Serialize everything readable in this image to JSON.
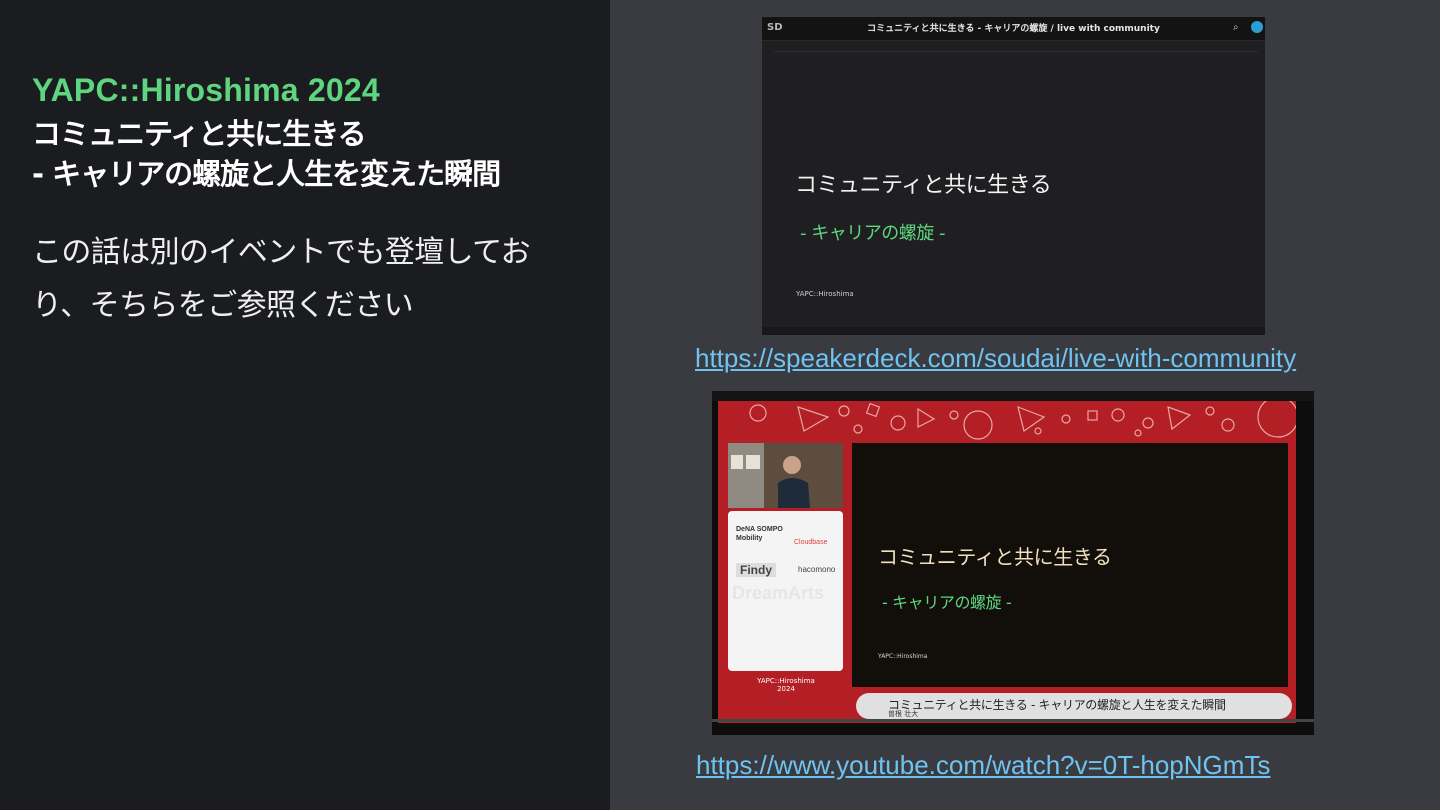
{
  "left": {
    "event": "YAPC::Hiroshima 2024",
    "title_line1": "コミュニティと共に生きる",
    "title_line2": "- キャリアの螺旋と人生を変えた瞬間",
    "body": "この話は別のイベントでも登壇しており、そちらをご参照ください"
  },
  "speakerdeck": {
    "logo": "SD",
    "page_title": "コミュニティと共に生きる - キャリアの螺旋 / live with community",
    "slide_title": "コミュニティと共に生きる",
    "slide_subtitle": "-  キャリアの螺旋 -",
    "slide_footer": "YAPC::Hiroshima",
    "link": "https://speakerdeck.com/soudai/live-with-community"
  },
  "youtube": {
    "slide_title": "コミュニティと共に生きる",
    "slide_subtitle": "-  キャリアの螺旋 -",
    "slide_footer": "YAPC::Hiroshima",
    "sponsors": [
      "DeNA SOMPO Mobility",
      "Cloudbase",
      "Findy",
      "hacomono",
      "DreamArts"
    ],
    "brand": "YAPC::Hiroshima 2024",
    "caption_title": "コミュニティと共に生きる - キャリアの螺旋と人生を変えた瞬間",
    "caption_speaker": "曽根 壮大",
    "link": "https://www.youtube.com/watch?v=0T-hopNGmTs"
  },
  "colors": {
    "accent_green": "#5ed57f",
    "link_blue": "#6fc3f0",
    "left_bg": "#1b1c1f",
    "right_bg": "#393b40"
  }
}
